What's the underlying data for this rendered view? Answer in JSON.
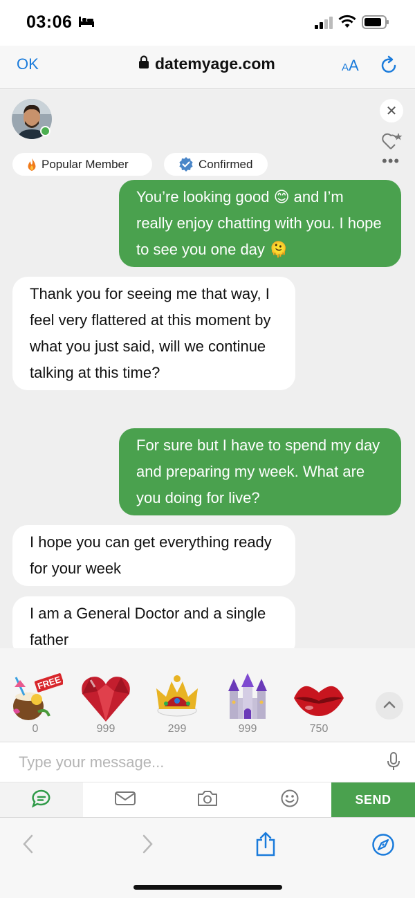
{
  "status_bar": {
    "time": "03:06"
  },
  "browser": {
    "ok_label": "OK",
    "url": "datemyage.com",
    "text_size_small": "A",
    "text_size_large": "A"
  },
  "profile": {
    "badges": [
      {
        "label": "Popular Member",
        "icon": "flame-icon"
      },
      {
        "label": "Confirmed",
        "icon": "verified-icon"
      }
    ],
    "close_glyph": "✕",
    "more_glyph": "•••"
  },
  "messages": [
    {
      "direction": "sent",
      "text": "You’re looking good 😊 and I’m really enjoy chatting with you. I hope to see you one day 🫠"
    },
    {
      "direction": "received",
      "text": "Thank you for seeing me that way, I feel very flattered at this moment by what you just said, will we continue talking at this time?"
    },
    {
      "direction": "sent",
      "text": "For sure but I have to spend my day and preparing my week. What are you doing for live?"
    },
    {
      "direction": "received",
      "text": "I hope you can get everything ready for your week"
    },
    {
      "direction": "received",
      "text": "I am a General Doctor and a single father"
    }
  ],
  "gifts": [
    {
      "name": "coconut-cocktail",
      "tag": "FREE",
      "price": "0"
    },
    {
      "name": "ruby-heart",
      "price": "999"
    },
    {
      "name": "crown",
      "price": "299"
    },
    {
      "name": "castle",
      "price": "999"
    },
    {
      "name": "lips",
      "price": "750"
    }
  ],
  "input": {
    "placeholder": "Type your message..."
  },
  "toolbar": {
    "send_label": "SEND"
  },
  "colors": {
    "accent_green": "#4aa14e",
    "link_blue": "#1a7bdb"
  }
}
